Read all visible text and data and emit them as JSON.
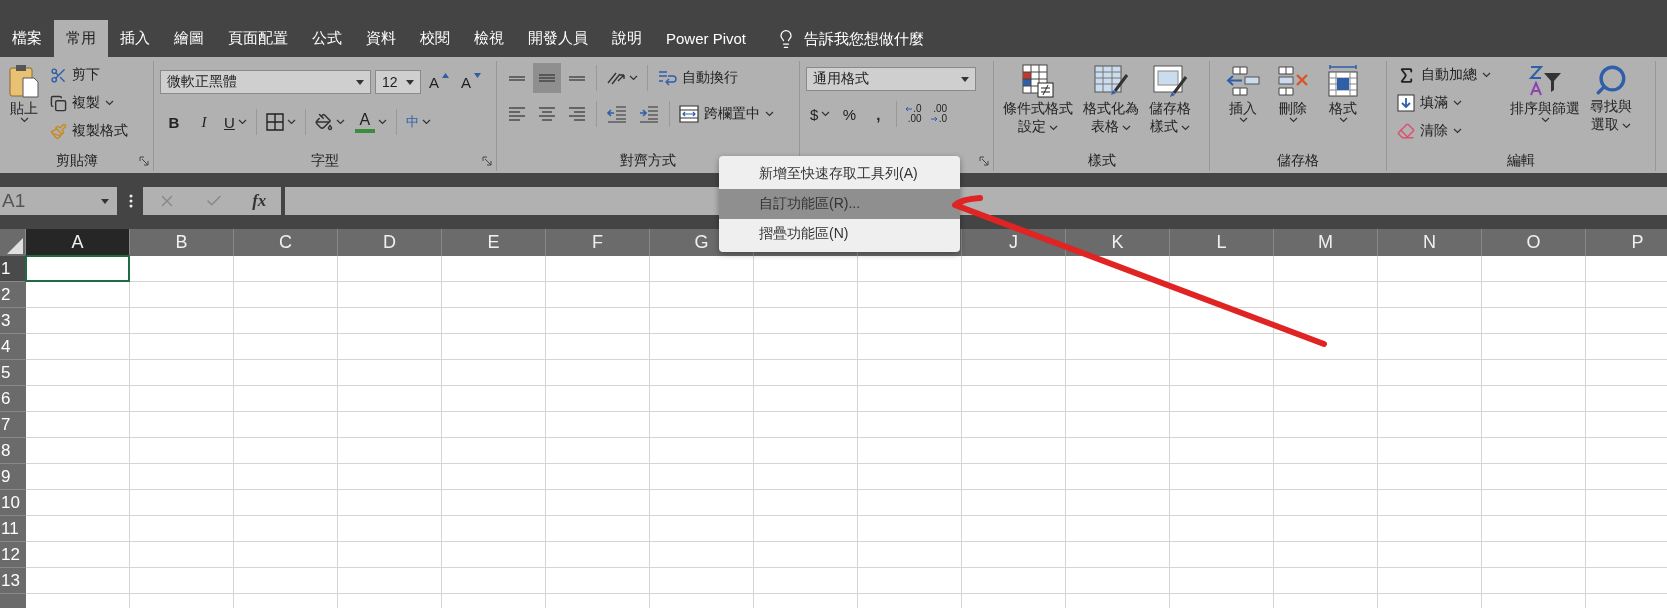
{
  "tabs": [
    {
      "label": "檔案",
      "selected": false
    },
    {
      "label": "常用",
      "selected": true
    },
    {
      "label": "插入",
      "selected": false
    },
    {
      "label": "繪圖",
      "selected": false
    },
    {
      "label": "頁面配置",
      "selected": false
    },
    {
      "label": "公式",
      "selected": false
    },
    {
      "label": "資料",
      "selected": false
    },
    {
      "label": "校閱",
      "selected": false
    },
    {
      "label": "檢視",
      "selected": false
    },
    {
      "label": "開發人員",
      "selected": false
    },
    {
      "label": "說明",
      "selected": false
    },
    {
      "label": "Power Pivot",
      "selected": false
    }
  ],
  "tell_me": {
    "placeholder": "告訴我您想做什麼"
  },
  "ribbon": {
    "clipboard": {
      "label": "剪貼簿",
      "paste": "貼上",
      "cut": "剪下",
      "copy": "複製",
      "format_painter": "複製格式"
    },
    "font": {
      "label": "字型",
      "font_name": "微軟正黑體",
      "font_size": "12",
      "grow": "A",
      "shrink": "A",
      "bold": "B",
      "italic": "I",
      "underline": "U",
      "font_color": "A",
      "phonetic": "中"
    },
    "alignment": {
      "label": "對齊方式",
      "vertical": [
        {
          "selected": false
        },
        {
          "selected": true
        },
        {
          "selected": false
        }
      ],
      "wrap_text": "自動換行",
      "merge_center": "跨欄置中"
    },
    "number": {
      "format": "通用格式",
      "currency": "$",
      "percent": "%",
      "comma": ",",
      "increase_decimal": [
        ".0",
        ".00"
      ],
      "decrease_decimal": [
        ".00",
        ".0"
      ]
    },
    "styles": {
      "label": "樣式",
      "buttons": [
        {
          "kind": "conditional",
          "lines": [
            "條件式格式",
            "設定"
          ]
        },
        {
          "kind": "table",
          "lines": [
            "格式化為",
            "表格"
          ]
        },
        {
          "kind": "cell",
          "lines": [
            "儲存格",
            "樣式"
          ]
        }
      ]
    },
    "cells": {
      "label": "儲存格",
      "buttons": [
        {
          "kind": "insert",
          "label": "插入"
        },
        {
          "kind": "delete",
          "label": "刪除"
        },
        {
          "kind": "format",
          "label": "格式"
        }
      ]
    },
    "editing": {
      "label": "編輯",
      "autosum": "自動加總",
      "fill": "填滿",
      "clear": "清除",
      "sort_filter": "排序與篩選",
      "find_select": [
        "尋找與",
        "選取"
      ]
    }
  },
  "formula_bar": {
    "name_box": "A1",
    "function": "fx"
  },
  "sheet": {
    "columns": [
      {
        "label": "A",
        "selected": true
      },
      {
        "label": "B",
        "selected": false
      },
      {
        "label": "C",
        "selected": false
      },
      {
        "label": "D",
        "selected": false
      },
      {
        "label": "E",
        "selected": false
      },
      {
        "label": "F",
        "selected": false
      },
      {
        "label": "G",
        "selected": false
      },
      {
        "selected": false
      },
      {
        "selected": false
      },
      {
        "label": "J",
        "selected": false
      },
      {
        "label": "K",
        "selected": false
      },
      {
        "label": "L",
        "selected": false
      },
      {
        "label": "M",
        "selected": false
      },
      {
        "label": "N",
        "selected": false
      },
      {
        "label": "O",
        "selected": false
      },
      {
        "label": "P",
        "selected": false
      }
    ],
    "rows": [
      {
        "label": "1",
        "selected": true
      },
      {
        "label": "2",
        "selected": false
      },
      {
        "label": "3",
        "selected": false
      },
      {
        "label": "4",
        "selected": false
      },
      {
        "label": "5",
        "selected": false
      },
      {
        "label": "6",
        "selected": false
      },
      {
        "label": "7",
        "selected": false
      },
      {
        "label": "8",
        "selected": false
      },
      {
        "label": "9",
        "selected": false
      },
      {
        "label": "10",
        "selected": false
      },
      {
        "label": "11",
        "selected": false
      },
      {
        "label": "12",
        "selected": false
      },
      {
        "label": "13",
        "selected": false
      }
    ]
  },
  "context_menu": {
    "items": [
      {
        "label": "新增至快速存取工具列(A)",
        "selected": false
      },
      {
        "label": "自訂功能區(R)...",
        "selected": true
      },
      {
        "label": "摺疊功能區(N)",
        "selected": false
      }
    ]
  }
}
